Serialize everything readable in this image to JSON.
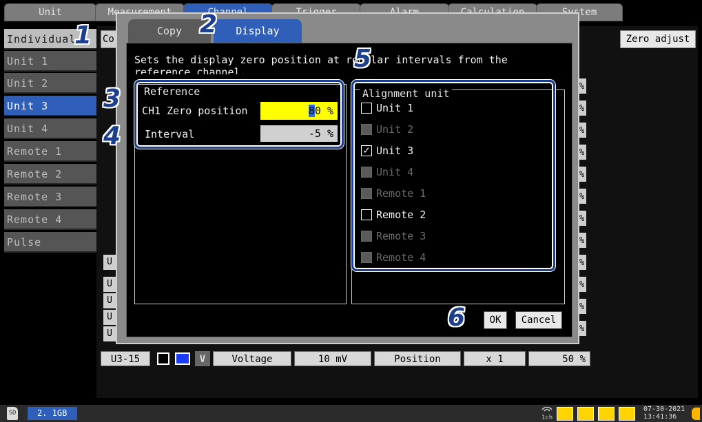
{
  "top_tabs": [
    "Unit",
    "Measurement",
    "Channel",
    "Trigger",
    "Alarm",
    "Calculation",
    "System"
  ],
  "sidebar": {
    "items": [
      "Individual",
      "Unit 1",
      "Unit 2",
      "Unit 3",
      "Unit 4",
      "Remote 1",
      "Remote 2",
      "Remote 3",
      "Remote 4",
      "Pulse"
    ],
    "selected": "Unit 3"
  },
  "background": {
    "header_fragment": "Co",
    "zero_adjust_label": "Zero adjust",
    "bottom_row": {
      "channel": "U3-15",
      "mode_letter": "V",
      "type": "Voltage",
      "range": "10 mV",
      "position_label": "Position",
      "multiplier": "x 1",
      "percent": "50 %"
    },
    "row_prefix": "U",
    "row_suffix": "%"
  },
  "dialog": {
    "tabs": [
      {
        "label": "Copy",
        "active": false
      },
      {
        "label": "Display",
        "active": true
      }
    ],
    "description_line1": "Sets the display zero position at regular intervals from the",
    "description_line2": "reference channel.",
    "reference": {
      "title": "Reference",
      "zero_label": "CH1 Zero position",
      "zero_value": "80",
      "zero_unit": "%",
      "interval_label": "Interval",
      "interval_value": "-5",
      "interval_unit": "%"
    },
    "alignment": {
      "title": "Alignment unit",
      "units": [
        {
          "label": "Unit 1",
          "checked": false,
          "enabled": true
        },
        {
          "label": "Unit 2",
          "checked": false,
          "enabled": false
        },
        {
          "label": "Unit 3",
          "checked": true,
          "enabled": true
        },
        {
          "label": "Unit 4",
          "checked": false,
          "enabled": false
        },
        {
          "label": "Remote 1",
          "checked": false,
          "enabled": false
        },
        {
          "label": "Remote 2",
          "checked": false,
          "enabled": true
        },
        {
          "label": "Remote 3",
          "checked": false,
          "enabled": false
        },
        {
          "label": "Remote 4",
          "checked": false,
          "enabled": false
        }
      ]
    },
    "ok_label": "OK",
    "cancel_label": "Cancel"
  },
  "callouts": [
    "1",
    "2",
    "3",
    "4",
    "5",
    "6"
  ],
  "status": {
    "storage": "2. 1GB",
    "wifi_label": "1ch",
    "date": "07-30-2021",
    "time": "13:41:36"
  },
  "colors": {
    "selected_blue": "#2f5fb8",
    "highlight_yellow": "#ffff00",
    "callout_blue": "#1d3f8f"
  }
}
